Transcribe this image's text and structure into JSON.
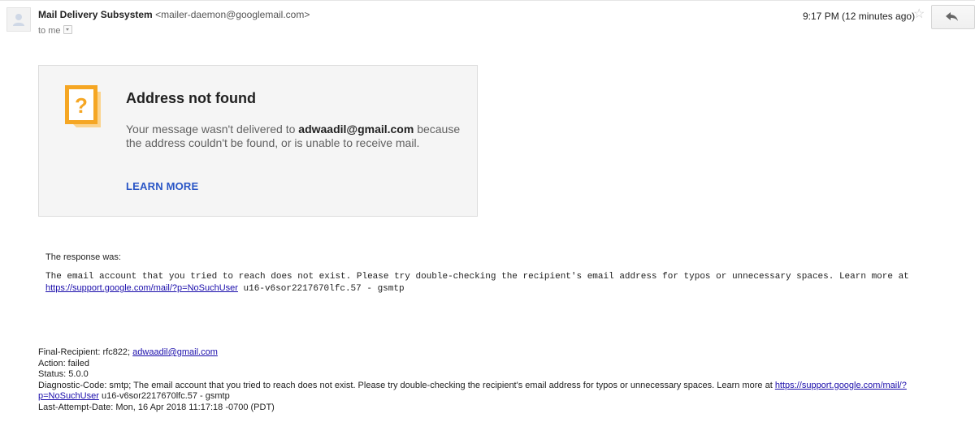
{
  "header": {
    "sender_name": "Mail Delivery Subsystem",
    "sender_email": "<mailer-daemon@googlemail.com>",
    "to_label": "to me",
    "time": "9:17 PM (12 minutes ago)",
    "star_glyph": "☆"
  },
  "card": {
    "title": "Address not found",
    "msg_prefix": "Your message wasn't delivered to ",
    "recipient": "adwaadil@gmail.com",
    "msg_suffix": " because the address couldn't be found, or is unable to receive mail.",
    "learn_more": "LEARN MORE",
    "icon_glyph": "?",
    "icon_color": "#f5a623"
  },
  "response": {
    "label": "The response was:",
    "line1": "The email account that you tried to reach does not exist. Please try double-checking the recipient's email address for typos or unnecessary spaces. Learn more at",
    "link": "https://support.google.com/mail/?p=NoSuchUser",
    "line2_rest": " u16-v6sor2217670lfc.57 - gsmtp"
  },
  "footer": {
    "final_recipient_label": "Final-Recipient: rfc822; ",
    "final_recipient_email": "adwaadil@gmail.com",
    "action": "Action: failed",
    "status": "Status: 5.0.0",
    "diag_text": "Diagnostic-Code: smtp; The email account that you tried to reach does not exist. Please try double-checking the recipient's email address for typos or unnecessary spaces. Learn more at ",
    "diag_link_part1": "https://support.google.com/mail/?",
    "diag_link_part2": "p=NoSuchUser",
    "diag_rest": " u16-v6sor2217670lfc.57 - gsmtp",
    "last_attempt": "Last-Attempt-Date: Mon, 16 Apr 2018 11:17:18 -0700 (PDT)"
  },
  "colors": {
    "link": "#1a0dab",
    "learn_more": "#2a56c6",
    "card_bg": "#f5f5f5"
  },
  "icons": [
    "avatar-icon",
    "dropdown-icon",
    "star-icon",
    "reply-icon",
    "question-mark-icon"
  ]
}
